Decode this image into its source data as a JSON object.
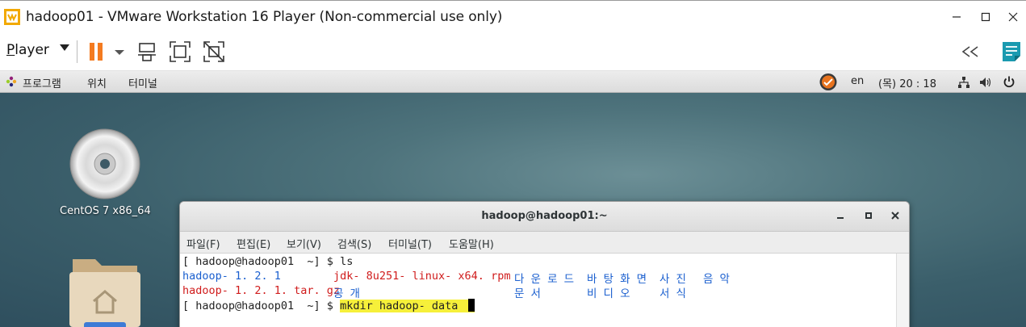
{
  "window": {
    "title": "hadoop01 - VMware Workstation 16 Player (Non-commercial use only)"
  },
  "toolbar": {
    "player_label_first": "P",
    "player_label_rest": "layer",
    "icons": [
      "pause-icon",
      "dropdown-caret-icon",
      "send-ctrl-alt-del-icon",
      "fullscreen-icon",
      "unity-icon",
      "collapse-icon",
      "notes-icon"
    ]
  },
  "gnome_bar": {
    "applications": "프로그램",
    "places": "위치",
    "terminal": "터미널",
    "lang": "en",
    "clock": "(목) 20 : 18"
  },
  "desktop": {
    "icons": [
      {
        "label": "CentOS 7 x86_64"
      }
    ]
  },
  "terminal": {
    "title": "hadoop@hadoop01:~",
    "menu": [
      "파일(F)",
      "편집(E)",
      "보기(V)",
      "검색(S)",
      "터미널(T)",
      "도움말(H)"
    ],
    "prompt": "[ hadoop@hadoop01  ~] $ ",
    "cmd1": "ls",
    "ls_col1": [
      "hadoop- 1. 2. 1",
      "hadoop- 1. 2. 1. tar. gz"
    ],
    "ls_col2": [
      "jdk- 8u251- linux- x64. rpm",
      "공 개"
    ],
    "ls_col3": [
      "다 운 로 드",
      "문 서"
    ],
    "ls_col4": [
      "바 탕 화 면",
      "비 디 오"
    ],
    "ls_col5": [
      "사 진",
      "서 식"
    ],
    "ls_col6": [
      "음 악"
    ],
    "cmd2": "mkdir hadoop- data "
  },
  "colors": {
    "dir_blue": "#1a5fcf",
    "archive_red": "#d01c1c",
    "highlight": "#f6f03a"
  }
}
